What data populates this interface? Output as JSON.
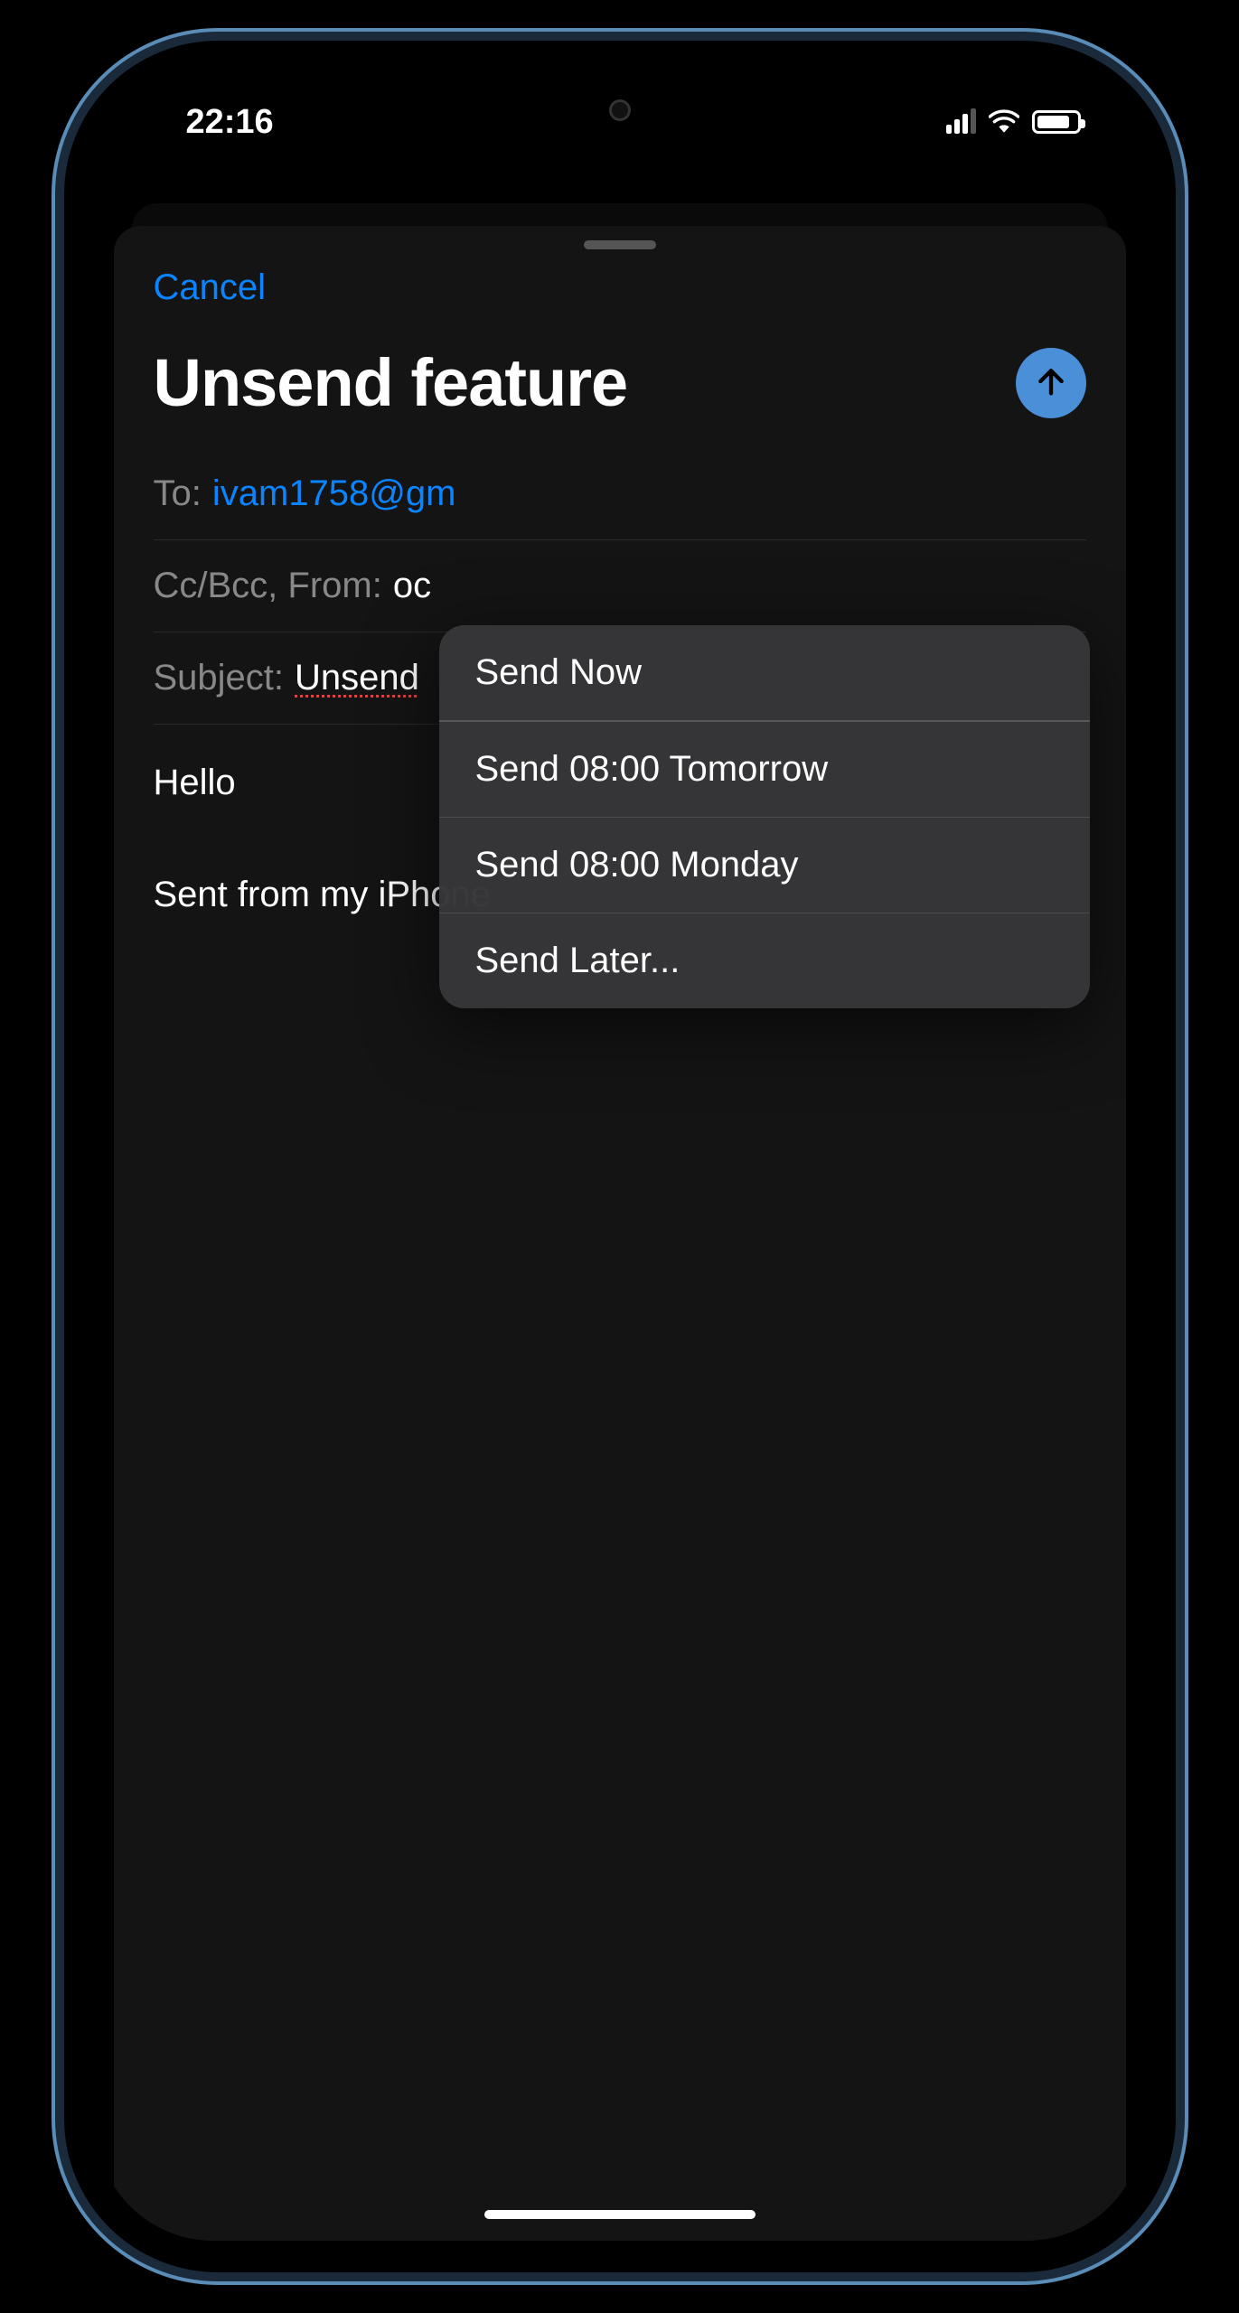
{
  "status": {
    "time": "22:16"
  },
  "sheet": {
    "cancel": "Cancel",
    "title": "Unsend feature"
  },
  "fields": {
    "to_label": "To:",
    "to_value": "ivam1758@gm",
    "ccbcc_label": "Cc/Bcc, From:",
    "ccbcc_value": "oc",
    "subject_label": "Subject:",
    "subject_value": "Unsend"
  },
  "body": {
    "line1": "Hello",
    "signature": "Sent from my iPhone"
  },
  "menu": {
    "item0": "Send Now",
    "item1": "Send 08:00 Tomorrow",
    "item2": "Send 08:00 Monday",
    "item3": "Send Later..."
  }
}
